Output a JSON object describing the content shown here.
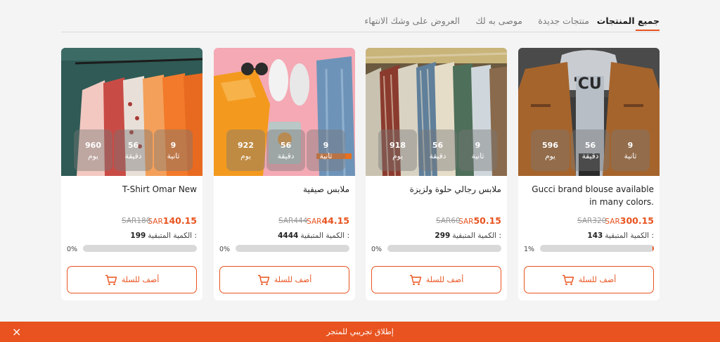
{
  "tabs": [
    {
      "label": "جميع المنتجات",
      "active": true
    },
    {
      "label": "منتجات جديدة"
    },
    {
      "label": "موصى به لك"
    },
    {
      "label": "العروض على وشك الانتهاء"
    }
  ],
  "products": [
    {
      "title": "Gucci brand blouse available in many colors.",
      "countdown": {
        "days": "596",
        "days_label": "يوم",
        "minutes": "56",
        "minutes_label": "دقيقة",
        "seconds": "9",
        "seconds_label": "ثانية"
      },
      "price": "300.15",
      "currency": "SAR",
      "old_price": "SAR320",
      "qty_label": "الكمية المتبقية :",
      "qty": "143",
      "progress_label": "1%",
      "progress": 0.01,
      "cart_label": "أضف للسلة"
    },
    {
      "title": "ملابس رجالي حلوة ولزيزة",
      "countdown": {
        "days": "918",
        "days_label": "يوم",
        "minutes": "56",
        "minutes_label": "دقيقة",
        "seconds": "9",
        "seconds_label": "ثانية"
      },
      "price": "50.15",
      "currency": "SAR",
      "old_price": "SAR60",
      "qty_label": "الكمية المتبقية :",
      "qty": "299",
      "progress_label": "0%",
      "progress": 0,
      "cart_label": "أضف للسلة"
    },
    {
      "title": "ملابس صيفية",
      "countdown": {
        "days": "922",
        "days_label": "يوم",
        "minutes": "56",
        "minutes_label": "دقيقة",
        "seconds": "9",
        "seconds_label": "ثانية"
      },
      "price": "44.15",
      "currency": "SAR",
      "old_price": "SAR444",
      "qty_label": "الكمية المتبقية :",
      "qty": "4444",
      "progress_label": "0%",
      "progress": 0,
      "cart_label": "أضف للسلة"
    },
    {
      "title": "T-Shirt Omar New",
      "countdown": {
        "days": "960",
        "days_label": "يوم",
        "minutes": "56",
        "minutes_label": "دقيقة",
        "seconds": "9",
        "seconds_label": "ثانية"
      },
      "price": "140.15",
      "currency": "SAR",
      "old_price": "SAR180",
      "qty_label": "الكمية المتبقية :",
      "qty": "199",
      "progress_label": "0%",
      "progress": 0,
      "cart_label": "أضف للسلة"
    }
  ],
  "footer": {
    "text": "إطلاق تجريبي للمتجر",
    "close_icon": "×"
  },
  "colors": {
    "accent": "#e8531f",
    "track": "#d9d9d9"
  }
}
